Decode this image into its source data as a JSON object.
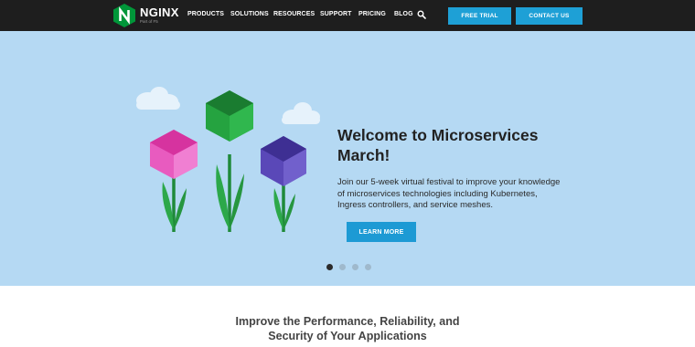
{
  "header": {
    "logo_word": "NGINX",
    "logo_sub": "Part of F5",
    "nav": [
      {
        "label": "PRODUCTS"
      },
      {
        "label": "SOLUTIONS"
      },
      {
        "label": "RESOURCES"
      },
      {
        "label": "SUPPORT"
      },
      {
        "label": "PRICING"
      },
      {
        "label": "BLOG"
      }
    ],
    "search_icon": "search-icon",
    "free_trial_label": "FREE TRIAL",
    "contact_label": "CONTACT US"
  },
  "hero": {
    "title": "Welcome to Microservices March!",
    "text": "Join our 5-week virtual festival to improve your knowledge of microservices technologies including Kubernetes, Ingress controllers, and service meshes.",
    "button_label": "LEARN MORE",
    "carousel": {
      "count": 4,
      "active": 1
    }
  },
  "section": {
    "title_line1": "Improve the Performance, Reliability, and",
    "title_line2": "Security of Your Applications"
  },
  "colors": {
    "topbar": "#1e1e1e",
    "accent": "#1ea0d6",
    "hero_bg": "#b5d9f3",
    "logo_green": "#009639"
  }
}
